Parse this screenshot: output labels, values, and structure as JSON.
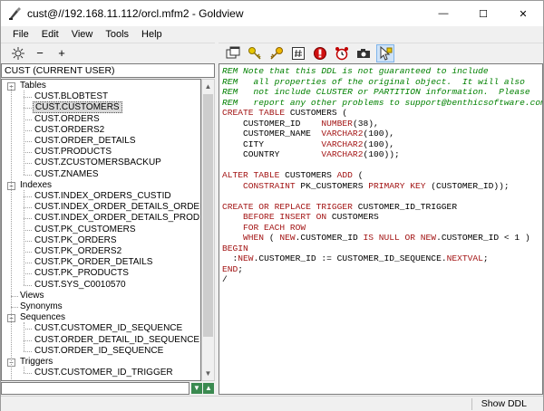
{
  "window": {
    "title": "cust@//192.168.11.112/orcl.mfm2 - Goldview",
    "minimize_glyph": "—",
    "maximize_glyph": "☐",
    "close_glyph": "✕"
  },
  "menu": [
    {
      "label": "File"
    },
    {
      "label": "Edit"
    },
    {
      "label": "View"
    },
    {
      "label": "Tools"
    },
    {
      "label": "Help"
    }
  ],
  "left_toolbar": {
    "icons": [
      "refresh-icon",
      "collapse-icon",
      "expand-icon"
    ],
    "minus_glyph": "−",
    "plus_glyph": "+"
  },
  "right_toolbar": {
    "icons": [
      "sql-window-icon",
      "key-icon",
      "key-gold-icon",
      "hash-icon",
      "stop-icon",
      "alarm-clock-icon",
      "camera-icon",
      "ddl-filter-icon"
    ]
  },
  "schema_selector": {
    "value": "CUST (CURRENT USER)"
  },
  "tree": {
    "rows": [
      {
        "label": "Tables",
        "level": 0,
        "toggle": "−"
      },
      {
        "label": "CUST.BLOBTEST",
        "level": 1
      },
      {
        "label": "CUST.CUSTOMERS",
        "level": 1,
        "selected": true
      },
      {
        "label": "CUST.ORDERS",
        "level": 1
      },
      {
        "label": "CUST.ORDERS2",
        "level": 1
      },
      {
        "label": "CUST.ORDER_DETAILS",
        "level": 1
      },
      {
        "label": "CUST.PRODUCTS",
        "level": 1
      },
      {
        "label": "CUST.ZCUSTOMERSBACKUP",
        "level": 1
      },
      {
        "label": "CUST.ZNAMES",
        "level": 1
      },
      {
        "label": "Indexes",
        "level": 0,
        "toggle": "−"
      },
      {
        "label": "CUST.INDEX_ORDERS_CUSTID",
        "level": 1
      },
      {
        "label": "CUST.INDEX_ORDER_DETAILS_ORDERID",
        "level": 1
      },
      {
        "label": "CUST.INDEX_ORDER_DETAILS_PRODID",
        "level": 1
      },
      {
        "label": "CUST.PK_CUSTOMERS",
        "level": 1
      },
      {
        "label": "CUST.PK_ORDERS",
        "level": 1
      },
      {
        "label": "CUST.PK_ORDERS2",
        "level": 1
      },
      {
        "label": "CUST.PK_ORDER_DETAILS",
        "level": 1
      },
      {
        "label": "CUST.PK_PRODUCTS",
        "level": 1
      },
      {
        "label": "CUST.SYS_C0010570",
        "level": 1
      },
      {
        "label": "Views",
        "level": 0
      },
      {
        "label": "Synonyms",
        "level": 0
      },
      {
        "label": "Sequences",
        "level": 0,
        "toggle": "−"
      },
      {
        "label": "CUST.CUSTOMER_ID_SEQUENCE",
        "level": 1
      },
      {
        "label": "CUST.ORDER_DETAIL_ID_SEQUENCE",
        "level": 1
      },
      {
        "label": "CUST.ORDER_ID_SEQUENCE",
        "level": 1
      },
      {
        "label": "Triggers",
        "level": 0,
        "toggle": "−"
      },
      {
        "label": "CUST.CUSTOMER_ID_TRIGGER",
        "level": 1
      }
    ]
  },
  "filter": {
    "value": ""
  },
  "nav_arrows": {
    "down": "▼",
    "up": "▲"
  },
  "ddl": {
    "lines": [
      [
        {
          "t": "REM Note that this DDL is not guaranteed to include",
          "c": "comment"
        }
      ],
      [
        {
          "t": "REM   all properties of the original object.  It will also",
          "c": "comment"
        }
      ],
      [
        {
          "t": "REM   not include CLUSTER or PARTITION information.  Please",
          "c": "comment"
        }
      ],
      [
        {
          "t": "REM   report any other problems to support@benthicsoftware.com",
          "c": "comment"
        }
      ],
      [
        {
          "t": "CREATE TABLE ",
          "c": "kw"
        },
        {
          "t": "CUSTOMERS (",
          "c": "plain"
        }
      ],
      [
        {
          "t": "    CUSTOMER_ID    ",
          "c": "plain"
        },
        {
          "t": "NUMBER",
          "c": "ty"
        },
        {
          "t": "(38),",
          "c": "plain"
        }
      ],
      [
        {
          "t": "    CUSTOMER_NAME  ",
          "c": "plain"
        },
        {
          "t": "VARCHAR2",
          "c": "ty"
        },
        {
          "t": "(100),",
          "c": "plain"
        }
      ],
      [
        {
          "t": "    CITY           ",
          "c": "plain"
        },
        {
          "t": "VARCHAR2",
          "c": "ty"
        },
        {
          "t": "(100),",
          "c": "plain"
        }
      ],
      [
        {
          "t": "    COUNTRY        ",
          "c": "plain"
        },
        {
          "t": "VARCHAR2",
          "c": "ty"
        },
        {
          "t": "(100));",
          "c": "plain"
        }
      ],
      [
        {
          "t": "",
          "c": "plain"
        }
      ],
      [
        {
          "t": "ALTER TABLE ",
          "c": "kw"
        },
        {
          "t": "CUSTOMERS ",
          "c": "plain"
        },
        {
          "t": "ADD",
          "c": "kw"
        },
        {
          "t": " (",
          "c": "plain"
        }
      ],
      [
        {
          "t": "    CONSTRAINT ",
          "c": "kw"
        },
        {
          "t": "PK_CUSTOMERS ",
          "c": "plain"
        },
        {
          "t": "PRIMARY KEY",
          "c": "kw"
        },
        {
          "t": " (CUSTOMER_ID));",
          "c": "plain"
        }
      ],
      [
        {
          "t": "",
          "c": "plain"
        }
      ],
      [
        {
          "t": "CREATE OR REPLACE TRIGGER ",
          "c": "kw"
        },
        {
          "t": "CUSTOMER_ID_TRIGGER",
          "c": "plain"
        }
      ],
      [
        {
          "t": "    BEFORE INSERT ON ",
          "c": "kw"
        },
        {
          "t": "CUSTOMERS",
          "c": "plain"
        }
      ],
      [
        {
          "t": "    FOR EACH ROW",
          "c": "kw"
        }
      ],
      [
        {
          "t": "    WHEN ",
          "c": "kw"
        },
        {
          "t": "( ",
          "c": "plain"
        },
        {
          "t": "NEW",
          "c": "kw"
        },
        {
          "t": ".CUSTOMER_ID ",
          "c": "plain"
        },
        {
          "t": "IS NULL OR NEW",
          "c": "kw"
        },
        {
          "t": ".CUSTOMER_ID < 1 )",
          "c": "plain"
        }
      ],
      [
        {
          "t": "BEGIN",
          "c": "kw"
        }
      ],
      [
        {
          "t": "  :",
          "c": "plain"
        },
        {
          "t": "NEW",
          "c": "kw"
        },
        {
          "t": ".CUSTOMER_ID := CUSTOMER_ID_SEQUENCE.",
          "c": "plain"
        },
        {
          "t": "NEXTVAL",
          "c": "kw"
        },
        {
          "t": ";",
          "c": "plain"
        }
      ],
      [
        {
          "t": "END",
          "c": "kw"
        },
        {
          "t": ";",
          "c": "plain"
        }
      ],
      [
        {
          "t": "/",
          "c": "plain"
        }
      ]
    ]
  },
  "status": {
    "text": "Show DDL"
  }
}
